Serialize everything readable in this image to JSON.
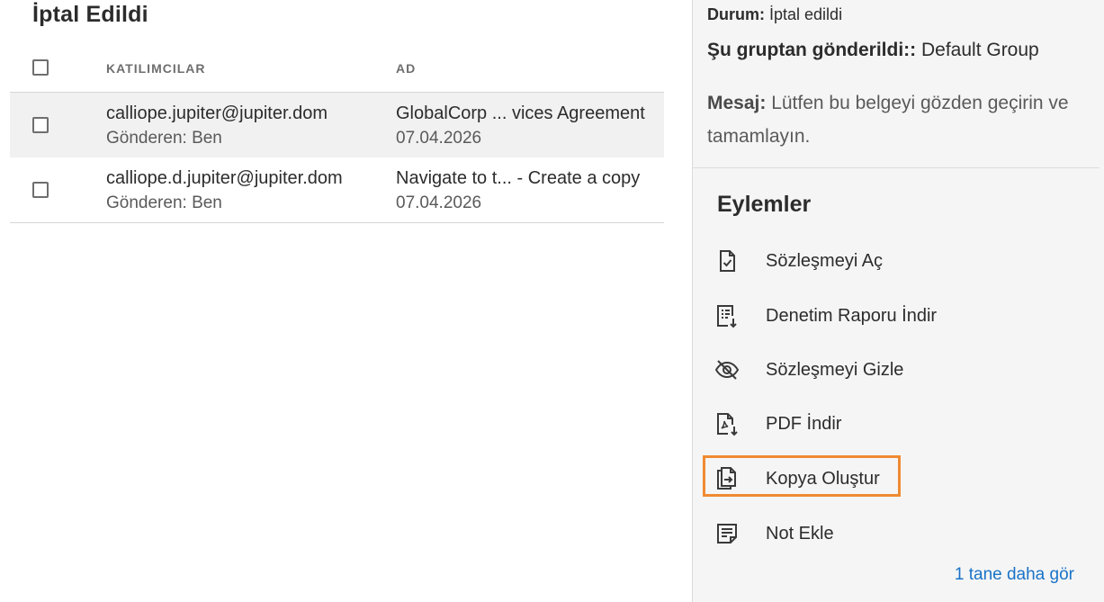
{
  "list": {
    "title": "İptal Edildi",
    "columns": {
      "participants": "KATILIMCILAR",
      "name": "AD"
    },
    "rows": [
      {
        "participant": "calliope.jupiter@jupiter.dom",
        "sender": "Gönderen: Ben",
        "name": "GlobalCorp ...  vices Agreement",
        "date": "07.04.2026"
      },
      {
        "participant": "calliope.d.jupiter@jupiter.dom",
        "sender": "Gönderen: Ben",
        "name": "Navigate to t...  - Create a copy",
        "date": "07.04.2026"
      }
    ]
  },
  "details": {
    "status_label": "Durum:",
    "status_value": "İptal edildi",
    "group_label": "Şu gruptan gönderildi::",
    "group_value": "Default Group",
    "message_label": "Mesaj:",
    "message_value": "Lütfen bu belgeyi gözden geçirin ve tamamlayın."
  },
  "actions": {
    "title": "Eylemler",
    "items": [
      {
        "label": "Sözleşmeyi Aç",
        "icon": "open-agreement-icon"
      },
      {
        "label": "Denetim Raporu İndir",
        "icon": "download-audit-report-icon"
      },
      {
        "label": "Sözleşmeyi Gizle",
        "icon": "hide-eye-icon"
      },
      {
        "label": "PDF İndir",
        "icon": "download-pdf-icon"
      },
      {
        "label": "Kopya Oluştur",
        "icon": "copy-icon",
        "highlighted": true
      },
      {
        "label": "Not Ekle",
        "icon": "note-icon"
      }
    ],
    "more_link": "1 tane daha gör"
  },
  "colors": {
    "highlight": "#f08a32",
    "link": "#1a73c8",
    "selected_row": "#f1f1f1",
    "panel_bg": "#f5f5f5"
  }
}
